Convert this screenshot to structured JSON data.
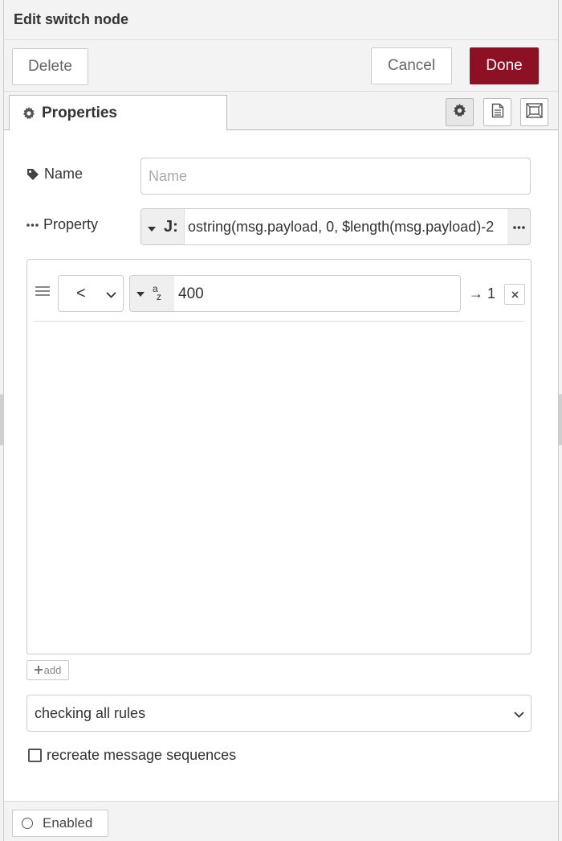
{
  "title": "Edit switch node",
  "toolbar": {
    "delete_label": "Delete",
    "cancel_label": "Cancel",
    "done_label": "Done",
    "done_color": "#8c1125"
  },
  "tabs": {
    "properties_label": "Properties"
  },
  "form": {
    "name_label": "Name",
    "name_placeholder": "Name",
    "name_value": "",
    "property_label": "Property",
    "property_type_glyph": "J:",
    "property_value": "ostring(msg.payload, 0, $length(msg.payload)-2"
  },
  "rules": [
    {
      "operator": "<",
      "value_type": "string",
      "value": "400",
      "output": "→ 1"
    }
  ],
  "add_label": "add",
  "checking_mode": "checking all rules",
  "recreate_label": "recreate message sequences",
  "recreate_checked": false,
  "footer": {
    "enabled_label": "Enabled"
  },
  "icons": [
    "gear-icon",
    "tag-icon",
    "dots-icon",
    "caret-down-icon",
    "chevron-down-icon",
    "close-icon",
    "plus-icon",
    "document-icon",
    "frame-icon",
    "drag-handle-icon",
    "circle-icon"
  ]
}
